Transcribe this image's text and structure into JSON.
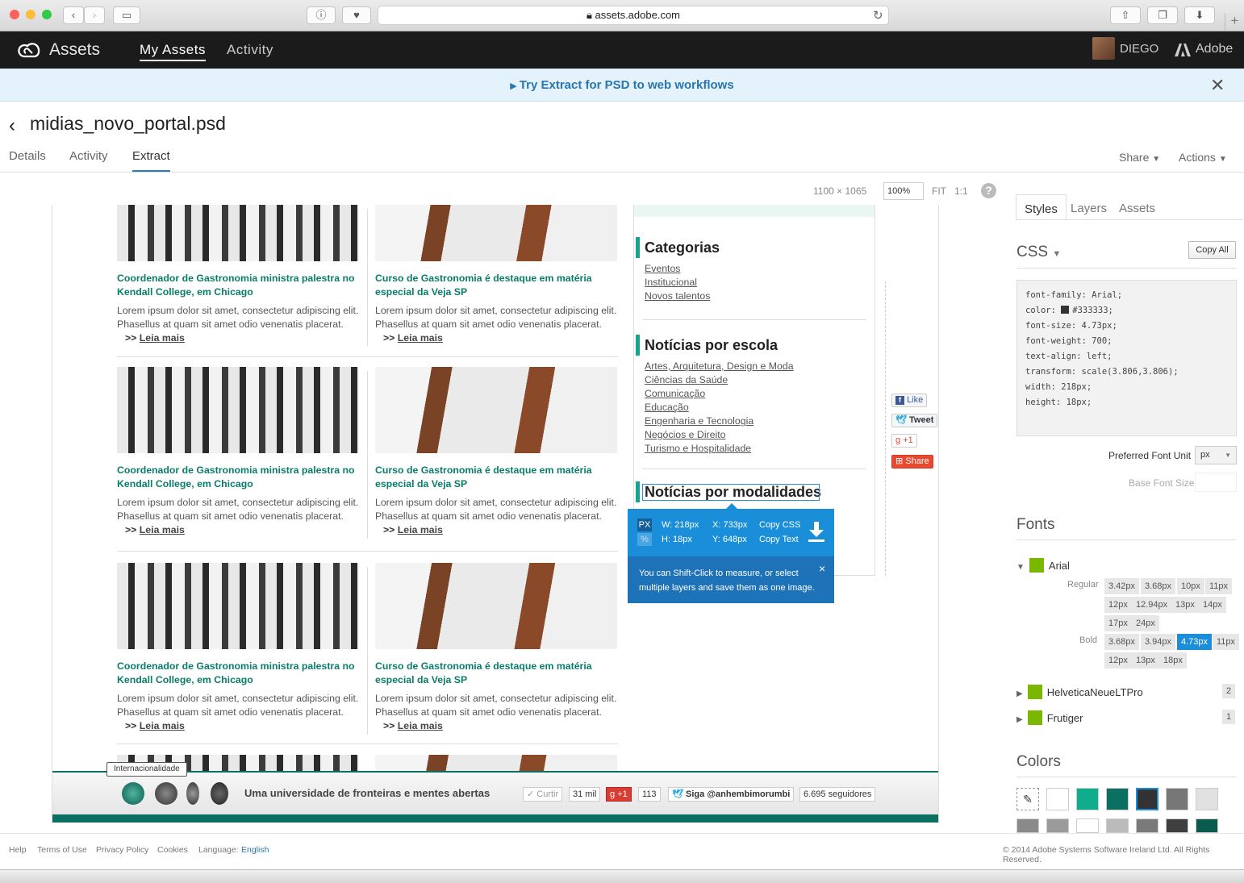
{
  "browser": {
    "url": "assets.adobe.com"
  },
  "app": {
    "name": "Assets",
    "nav": [
      {
        "label": "My Assets"
      },
      {
        "label": "Activity"
      }
    ],
    "user": "DIEGO",
    "brand": "Adobe"
  },
  "banner": {
    "text": "Try Extract for PSD to web workflows"
  },
  "file": {
    "title": "midias_novo_portal.psd",
    "tabs": [
      {
        "label": "Details"
      },
      {
        "label": "Activity"
      },
      {
        "label": "Extract"
      }
    ],
    "share": "Share",
    "actions": "Actions"
  },
  "canvas_toolbar": {
    "size": "1100 × 1065",
    "zoom": "100%",
    "fit": "FIT",
    "one_to_one": "1:1",
    "help": "?"
  },
  "doc": {
    "news_title_a": "Coordenador de Gastronomia ministra palestra no Kendall College, em Chicago",
    "news_title_b": "Curso de Gastronomia é destaque em matéria especial da Veja SP",
    "news_body": "Lorem ipsum dolor sit amet, consectetur adipiscing elit. Phasellus at quam sit amet odio venenatis placerat.",
    "more_prefix": ">>",
    "more_link": "Leia mais",
    "sidebar": {
      "categorias": {
        "title": "Categorias",
        "links": [
          "Eventos",
          "Institucional",
          "Novos talentos"
        ]
      },
      "escola": {
        "title": "Notícias por escola",
        "links": [
          "Artes, Arquitetura, Design e Moda",
          "Ciências da Saúde",
          "Comunicação",
          "Educação",
          "Engenharia e Tecnologia",
          "Negócios e Direito",
          "Turismo e Hospitalidade"
        ]
      },
      "modalidades": {
        "title": "Notícias por modalidades"
      }
    },
    "social": {
      "like": "Like",
      "tweet": "Tweet",
      "plus": "+1",
      "share": "Share"
    },
    "footer": {
      "tooltip": "Internacionalidade",
      "slogan": "Uma universidade de fronteiras e mentes abertas",
      "curtir": "Curtir",
      "curtir_count": "31 mil",
      "gplus": "+1",
      "gplus_count": "113",
      "siga": "Siga @anhembimorumbi",
      "seguidores": "6.695 seguidores"
    }
  },
  "measure": {
    "px": "PX",
    "pct": "%",
    "w": "W: 218px",
    "h": "H: 18px",
    "x": "X: 733px",
    "y": "Y: 648px",
    "copy_css": "Copy CSS",
    "copy_text": "Copy Text",
    "hint": "You can Shift-Click to measure, or select multiple layers and save them as one image.",
    "close": "×"
  },
  "panel": {
    "tabs": [
      {
        "label": "Styles"
      },
      {
        "label": "Layers"
      },
      {
        "label": "Assets"
      }
    ],
    "css_header": "CSS",
    "copy_all": "Copy All",
    "css_lines": [
      "font-family: Arial;",
      "color:",
      "#333333;",
      "font-size: 4.73px;",
      "font-weight: 700;",
      "text-align: left;",
      "transform: scale(3.806,3.806);",
      "width: 218px;",
      "height: 18px;"
    ],
    "pref_font_unit_label": "Preferred Font Unit",
    "pref_font_unit": "px",
    "base_font_size_label": "Base Font Size",
    "fonts_header": "Fonts",
    "fonts": [
      {
        "name": "Arial",
        "regular_label": "Regular",
        "regular": [
          "3.42px",
          "3.68px",
          "10px",
          "11px",
          "12px",
          "12.94px",
          "13px",
          "14px",
          "17px",
          "24px"
        ],
        "bold_label": "Bold",
        "bold": [
          "3.68px",
          "3.94px",
          "4.73px",
          "11px",
          "12px",
          "13px",
          "18px"
        ],
        "selected": "4.73px"
      },
      {
        "name": "HelveticaNeueLTPro",
        "count": "2"
      },
      {
        "name": "Frutiger",
        "count": "1"
      }
    ],
    "colors_header": "Colors",
    "colors": [
      "#ffffff",
      "#0fac8e",
      "#0b6f62",
      "#333333",
      "#777777",
      "#e1e1e1",
      "#8a8a8a",
      "#9a9a9a",
      "#ffffff",
      "#bbbbbb",
      "#7a7a7a",
      "#3f3f3f",
      "#0b5a4e"
    ]
  },
  "page_footer": {
    "help": "Help",
    "terms": "Terms of Use",
    "privacy": "Privacy Policy",
    "cookies": "Cookies",
    "language_label": "Language:",
    "language": "English",
    "copyright": "© 2014 Adobe Systems Software Ireland Ltd. All Rights Reserved."
  }
}
